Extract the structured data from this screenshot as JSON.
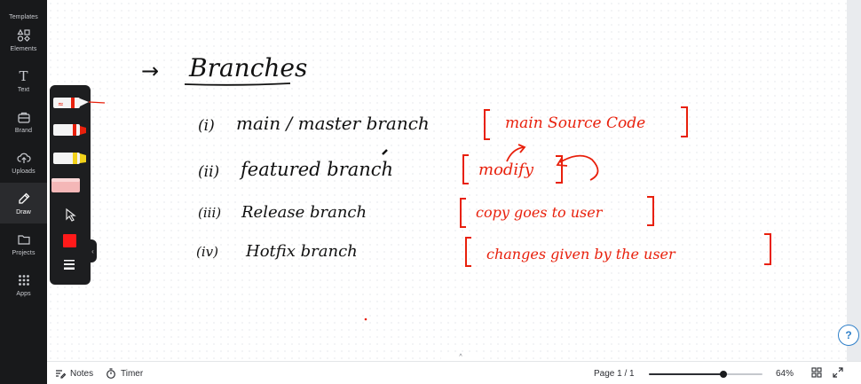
{
  "sidebar": {
    "items": [
      {
        "label": "Templates",
        "icon": "templates-icon"
      },
      {
        "label": "Elements",
        "icon": "elements-icon"
      },
      {
        "label": "Text",
        "icon": "text-icon"
      },
      {
        "label": "Brand",
        "icon": "brand-icon"
      },
      {
        "label": "Uploads",
        "icon": "uploads-icon"
      },
      {
        "label": "Draw",
        "icon": "draw-icon",
        "active": true
      },
      {
        "label": "Projects",
        "icon": "projects-icon"
      },
      {
        "label": "Apps",
        "icon": "apps-icon"
      }
    ]
  },
  "text_tool_glyph": "T",
  "whiteboard": {
    "title": "Branches",
    "arrow_glyph": "→",
    "items": [
      {
        "numeral": "(i)",
        "text": "main / master branch",
        "note": "main Source Code"
      },
      {
        "numeral": "(ii)",
        "text": "featured branch",
        "note": "modify"
      },
      {
        "numeral": "(iii)",
        "text": "Release branch",
        "note": "copy goes to user"
      },
      {
        "numeral": "(iv)",
        "text": "Hotfix branch",
        "note": "changes given by the user"
      }
    ]
  },
  "draw_tools": {
    "tools": [
      "pen",
      "marker",
      "highlighter",
      "eraser",
      "select"
    ],
    "color": "#ff1a1a",
    "collapse_glyph": "‹"
  },
  "bottombar": {
    "notes_label": "Notes",
    "timer_label": "Timer",
    "page_label": "Page 1 / 1",
    "zoom_label": "64%",
    "zoom_fraction": 0.66,
    "handle_glyph": "^"
  },
  "help_glyph": "?",
  "colors": {
    "ink_black": "#111111",
    "ink_red": "#e8200c",
    "rail_bg": "#18191b"
  }
}
